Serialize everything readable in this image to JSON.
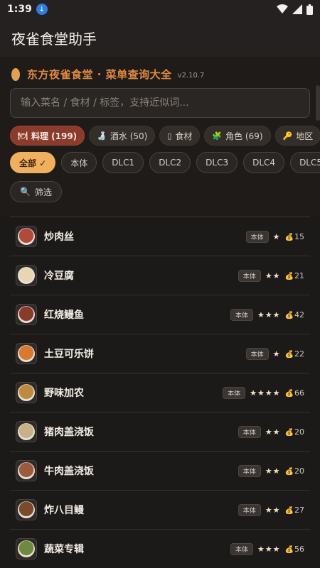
{
  "status": {
    "time": "1:39"
  },
  "appbar": {
    "title": "夜雀食堂助手"
  },
  "header": {
    "title": "东方夜雀食堂 · 菜单查询大全",
    "version": "v2.10.7"
  },
  "search": {
    "placeholder": "输入菜名 / 食材 / 标签，支持近似词..."
  },
  "tabs": [
    {
      "icon": "🍽",
      "label": "料理 (199)"
    },
    {
      "icon": "🍶",
      "label": "酒水 (50)"
    },
    {
      "icon": "▯",
      "label": "食材"
    },
    {
      "icon": "🧩",
      "label": "角色 (69)"
    },
    {
      "icon": "🔑",
      "label": "地区"
    }
  ],
  "dlcs": [
    "全部 ✓",
    "本体",
    "DLC1",
    "DLC2",
    "DLC3",
    "DLC4",
    "DLC5"
  ],
  "filter": {
    "icon": "🔍",
    "label": "筛选"
  },
  "dishes": [
    {
      "name": "炒肉丝",
      "badge": "本体",
      "stars": "★",
      "price": "15",
      "color": "#b24a3a"
    },
    {
      "name": "冷豆腐",
      "badge": "本体",
      "stars": "★★",
      "price": "21",
      "color": "#e8d6b0"
    },
    {
      "name": "红烧鳗鱼",
      "badge": "本体",
      "stars": "★★★",
      "price": "42",
      "color": "#8c3a28"
    },
    {
      "name": "土豆可乐饼",
      "badge": "本体",
      "stars": "★",
      "price": "22",
      "color": "#d9782e"
    },
    {
      "name": "野味加农",
      "badge": "本体",
      "stars": "★★★★",
      "price": "66",
      "color": "#c08a3c"
    },
    {
      "name": "猪肉盖浇饭",
      "badge": "本体",
      "stars": "★★",
      "price": "20",
      "color": "#c8b08a"
    },
    {
      "name": "牛肉盖浇饭",
      "badge": "本体",
      "stars": "★★",
      "price": "20",
      "color": "#9b5a3c"
    },
    {
      "name": "炸八目鳗",
      "badge": "本体",
      "stars": "★★",
      "price": "27",
      "color": "#7a4a2a"
    },
    {
      "name": "蔬菜专辑",
      "badge": "本体",
      "stars": "★★★",
      "price": "56",
      "color": "#6f8a3a"
    }
  ]
}
